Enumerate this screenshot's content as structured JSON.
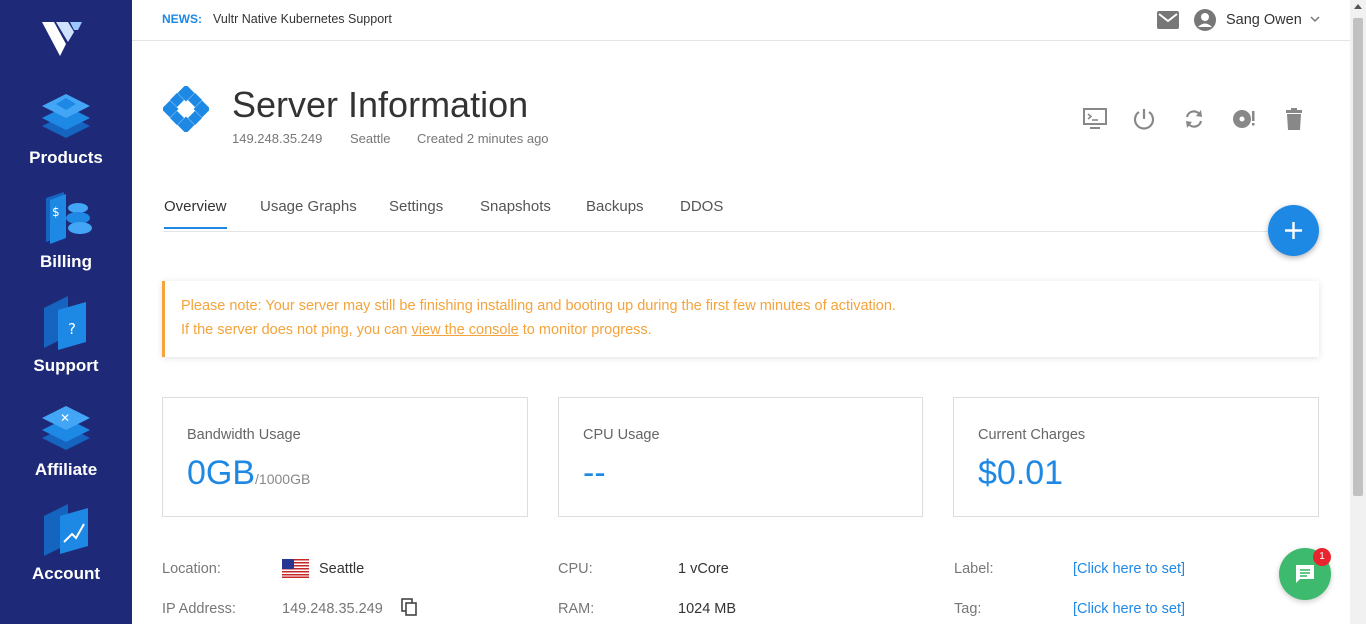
{
  "sidebar": {
    "items": [
      {
        "label": "Products",
        "icon": "products-icon"
      },
      {
        "label": "Billing",
        "icon": "billing-icon"
      },
      {
        "label": "Support",
        "icon": "support-icon"
      },
      {
        "label": "Affiliate",
        "icon": "affiliate-icon"
      },
      {
        "label": "Account",
        "icon": "account-icon"
      }
    ]
  },
  "topbar": {
    "news_tag": "NEWS:",
    "news_text": "Vultr Native Kubernetes Support",
    "user_name": "Sang Owen"
  },
  "header": {
    "title": "Server Information",
    "ip": "149.248.35.249",
    "location": "Seattle",
    "created": "Created 2 minutes ago"
  },
  "tabs": [
    "Overview",
    "Usage Graphs",
    "Settings",
    "Snapshots",
    "Backups",
    "DDOS"
  ],
  "active_tab": "Overview",
  "notice": {
    "line1": "Please note: Your server may still be finishing installing and booting up during the first few minutes of activation.",
    "line2_pre": "If the server does not ping, you can ",
    "line2_link": "view the console",
    "line2_post": " to monitor progress."
  },
  "cards": {
    "bandwidth": {
      "label": "Bandwidth Usage",
      "value": "0GB",
      "unit": "/1000GB"
    },
    "cpu": {
      "label": "CPU Usage",
      "value": "--"
    },
    "charges": {
      "label": "Current Charges",
      "value": "$0.01"
    }
  },
  "details": {
    "location_label": "Location:",
    "location_value": "Seattle",
    "ip_label": "IP Address:",
    "ip_value": "149.248.35.249",
    "cpu_label": "CPU:",
    "cpu_value": "1 vCore",
    "ram_label": "RAM:",
    "ram_value": "1024 MB",
    "label_label": "Label:",
    "label_value": "[Click here to set]",
    "tag_label": "Tag:",
    "tag_value": "[Click here to set]"
  },
  "chat": {
    "badge": "1"
  },
  "colors": {
    "sidebar_bg": "#1e2a78",
    "accent": "#1e88e5",
    "warning": "#f5a33b",
    "chat": "#3dba6e",
    "badge": "#e8242e"
  }
}
